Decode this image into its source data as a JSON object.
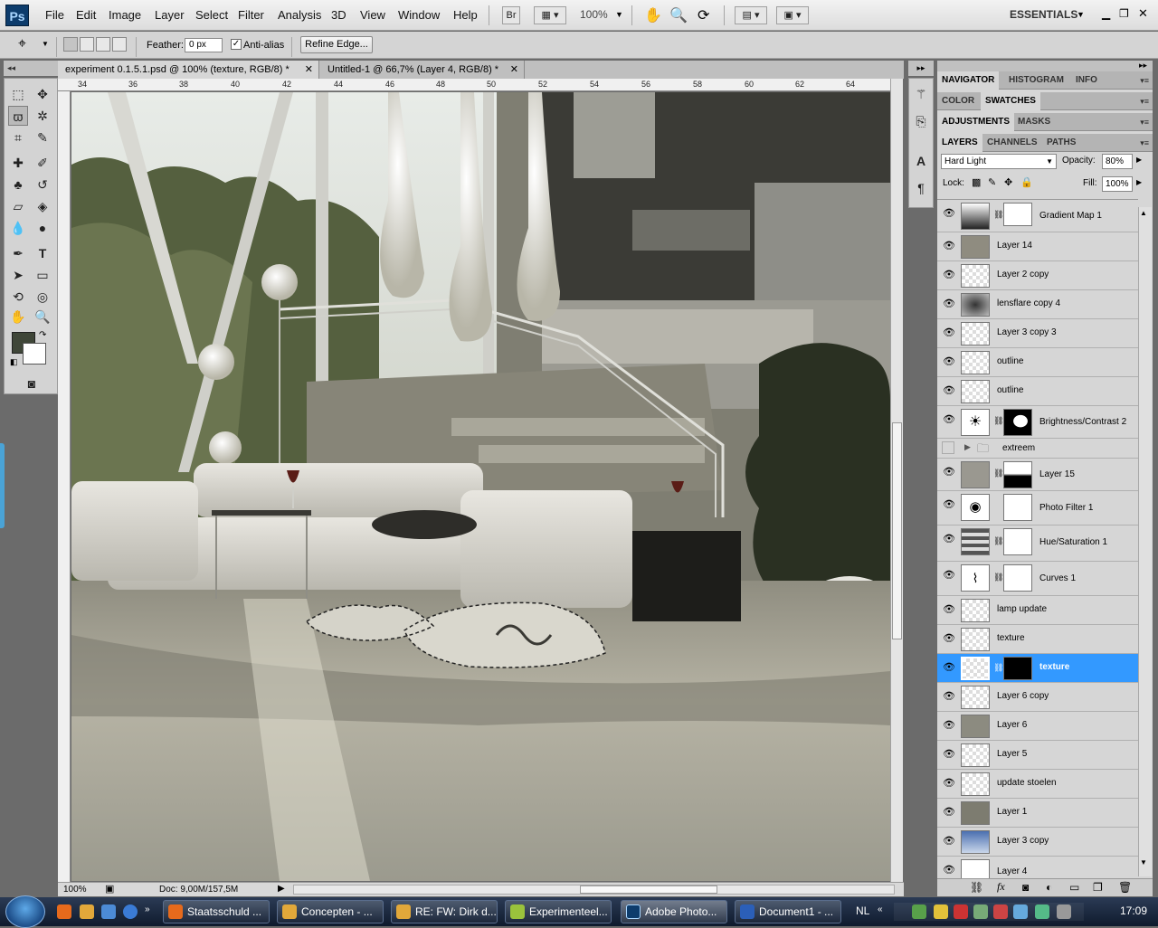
{
  "menubar": {
    "logo": "Ps",
    "items": [
      "File",
      "Edit",
      "Image",
      "Layer",
      "Select",
      "Filter",
      "Analysis",
      "3D",
      "View",
      "Window",
      "Help"
    ],
    "bridge": "Br",
    "zoom": "100%",
    "workspace": "ESSENTIALS"
  },
  "options": {
    "feather_label": "Feather:",
    "feather_value": "0 px",
    "antialias_label": "Anti-alias",
    "refine_label": "Refine Edge..."
  },
  "tabs": [
    {
      "label": "experiment 0.1.5.1.psd @ 100% (texture, RGB/8) *",
      "close": "✕"
    },
    {
      "label": "Untitled-1 @ 66,7% (Layer 4, RGB/8) *",
      "close": "✕"
    }
  ],
  "ruler": {
    "top": [
      "34",
      "36",
      "38",
      "40",
      "42",
      "44",
      "46",
      "48",
      "50",
      "52",
      "54",
      "56",
      "58",
      "60",
      "62",
      "64"
    ]
  },
  "status": {
    "zoom": "100%",
    "doc": "Doc: 9,00M/157,5M"
  },
  "panels": {
    "row1": [
      "NAVIGATOR",
      "HISTOGRAM",
      "INFO"
    ],
    "row2": [
      "COLOR",
      "SWATCHES"
    ],
    "row3": [
      "ADJUSTMENTS",
      "MASKS"
    ],
    "row4": [
      "LAYERS",
      "CHANNELS",
      "PATHS"
    ],
    "blend_mode": "Hard Light",
    "opacity_label": "Opacity:",
    "opacity": "80%",
    "lock_label": "Lock:",
    "fill_label": "Fill:",
    "fill": "100%"
  },
  "layers": [
    {
      "name": "Gradient Map 1"
    },
    {
      "name": "Layer 14"
    },
    {
      "name": "Layer 2 copy"
    },
    {
      "name": "lensflare copy 4"
    },
    {
      "name": "Layer 3 copy 3"
    },
    {
      "name": "outline"
    },
    {
      "name": "outline"
    },
    {
      "name": "Brightness/Contrast 2"
    },
    {
      "name": "extreem"
    },
    {
      "name": "Layer 15"
    },
    {
      "name": "Photo Filter 1"
    },
    {
      "name": "Hue/Saturation 1"
    },
    {
      "name": "Curves 1"
    },
    {
      "name": "lamp update"
    },
    {
      "name": "texture"
    },
    {
      "name": "texture"
    },
    {
      "name": "Layer 6 copy"
    },
    {
      "name": "Layer 6"
    },
    {
      "name": "Layer 5"
    },
    {
      "name": "update stoelen"
    },
    {
      "name": "Layer 1"
    },
    {
      "name": "Layer 3 copy"
    },
    {
      "name": "Layer 4"
    }
  ],
  "taskbar": {
    "buttons": [
      "Staatsschuld ...",
      "Concepten - ...",
      "RE: FW: Dirk d...",
      "Experimenteel...",
      "Adobe Photo...",
      "Document1 - ..."
    ],
    "lang": "NL",
    "clock": "17:09"
  }
}
